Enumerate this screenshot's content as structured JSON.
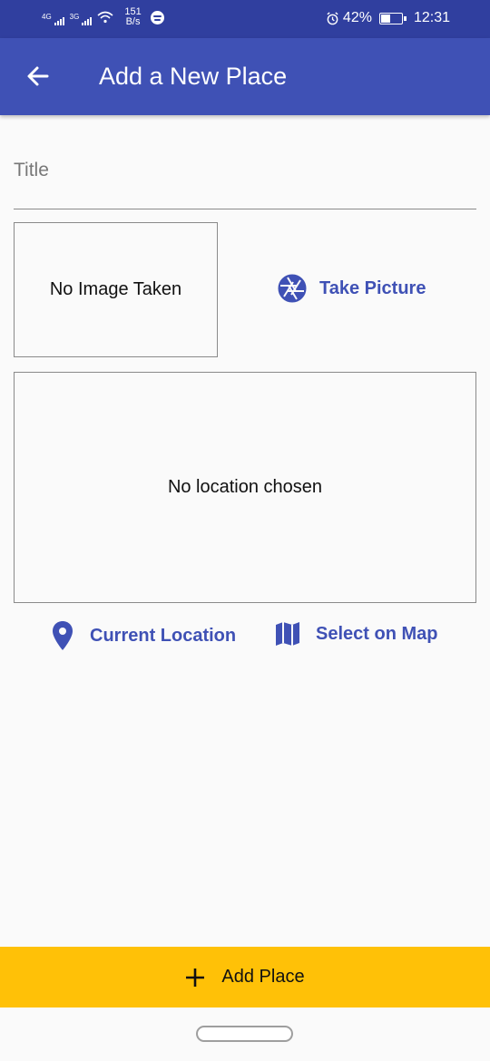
{
  "status_bar": {
    "network_1": "4G",
    "network_2": "3G",
    "speed_value": "151",
    "speed_unit": "B/s",
    "battery": "42%",
    "time": "12:31",
    "icons": [
      "signal-icon",
      "wifi-icon",
      "spotify-icon",
      "alarm-icon",
      "battery-icon"
    ]
  },
  "app_bar": {
    "title": "Add a New Place",
    "back_icon": "arrow-back-icon"
  },
  "form": {
    "title_placeholder": "Title",
    "title_value": "",
    "image_preview_text": "No Image Taken",
    "take_picture_label": "Take Picture",
    "take_picture_icon": "camera-aperture-icon",
    "location_preview_text": "No location chosen",
    "current_location_label": "Current Location",
    "current_location_icon": "location-pin-icon",
    "select_on_map_label": "Select on Map",
    "select_on_map_icon": "map-icon"
  },
  "bottom_button": {
    "label": "Add Place",
    "icon": "add-icon"
  },
  "colors": {
    "status_bar": "#303f9f",
    "primary": "#3f51b5",
    "accent": "#ffc107",
    "background": "#fafafa"
  }
}
